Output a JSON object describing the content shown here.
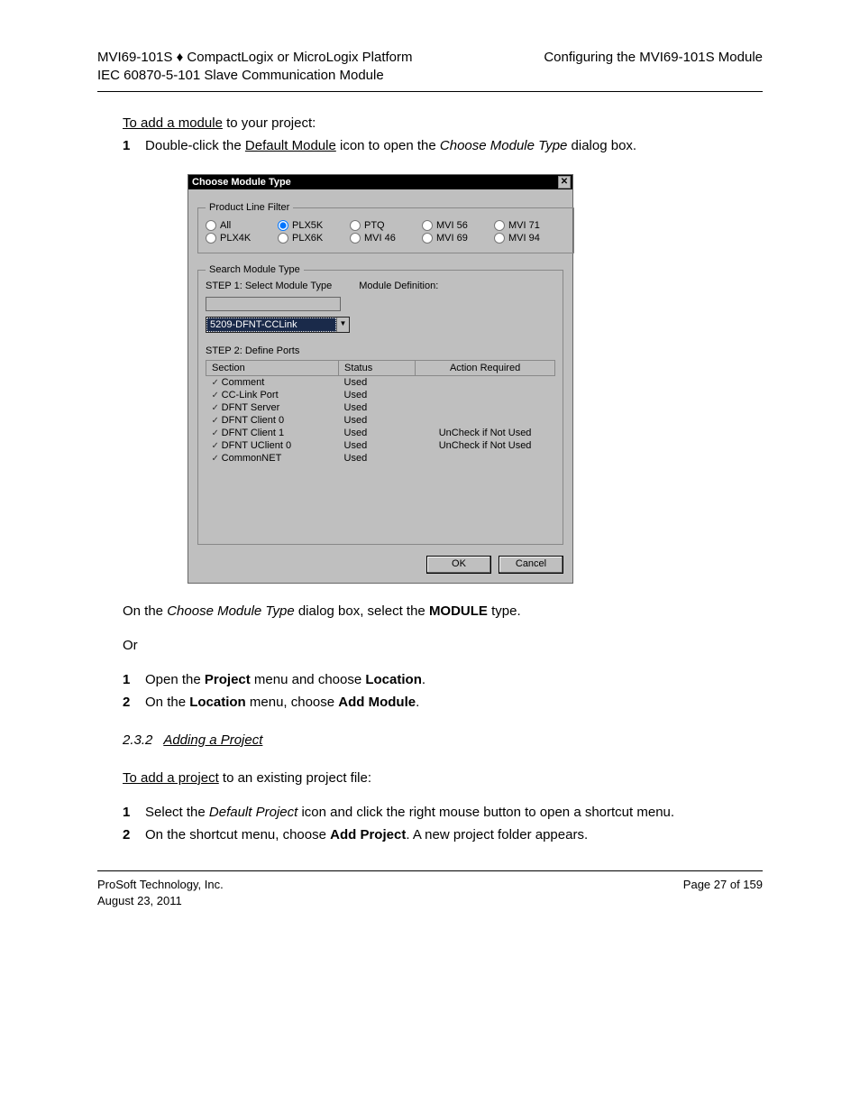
{
  "header": {
    "left_line1_a": "MVI69-101S",
    "left_line1_b": "CompactLogix or MicroLogix Platform",
    "left_line2": "IEC 60870-5-101 Slave Communication Module",
    "right_line1": "Configuring the MVI69-101S Module",
    "diamond": "♦"
  },
  "intro": {
    "line1_a": "To add a module",
    "line1_b": " to your project:",
    "step_label": "1",
    "step_text_a": "Double-click the ",
    "step_text_b": "Default Module",
    "step_text_c": " icon to open the ",
    "step_text_d": "Choose Module Type",
    "step_text_e": " dialog box."
  },
  "dialog": {
    "title": "Choose Module Type",
    "close": "✕",
    "fieldsets": {
      "product_line": "Product Line Filter",
      "search_module": "Search Module Type"
    },
    "radios": {
      "row1": [
        {
          "label": "All",
          "checked": false
        },
        {
          "label": "PLX5K",
          "checked": true
        },
        {
          "label": "PTQ",
          "checked": false
        },
        {
          "label": "MVI 56",
          "checked": false
        },
        {
          "label": "MVI 71",
          "checked": false
        }
      ],
      "row2": [
        {
          "label": "PLX4K",
          "checked": false
        },
        {
          "label": "PLX6K",
          "checked": false
        },
        {
          "label": "MVI 46",
          "checked": false
        },
        {
          "label": "MVI 69",
          "checked": false
        },
        {
          "label": "MVI 94",
          "checked": false
        }
      ]
    },
    "smt": {
      "step1": "STEP 1: Select Module Type",
      "moddef": "Module Definition:",
      "combo_value": "5209-DFNT-CCLink",
      "combo_btn": "▼",
      "step2": "STEP 2: Define Ports"
    },
    "table": {
      "headers": {
        "section": "Section",
        "status": "Status",
        "action": "Action Required"
      },
      "rows": [
        {
          "section": "Comment",
          "status": "Used",
          "action": ""
        },
        {
          "section": "CC-Link Port",
          "status": "Used",
          "action": ""
        },
        {
          "section": "DFNT Server",
          "status": "Used",
          "action": ""
        },
        {
          "section": "DFNT Client 0",
          "status": "Used",
          "action": ""
        },
        {
          "section": "DFNT Client 1",
          "status": "Used",
          "action": "UnCheck if Not Used"
        },
        {
          "section": "DFNT UClient 0",
          "status": "Used",
          "action": "UnCheck if Not Used"
        },
        {
          "section": "CommonNET",
          "status": "Used",
          "action": ""
        }
      ]
    },
    "buttons": {
      "ok": "OK",
      "cancel": "Cancel"
    }
  },
  "after": {
    "p1_a": "On the ",
    "p1_b": "Choose Module Type",
    "p1_c": " dialog box, select the ",
    "p1_d": "MODULE",
    "p1_e": " type.",
    "p2": "Or",
    "p3_a": "1",
    "p3_b": "Open the ",
    "p3_c": "Project",
    "p3_d": " menu and choose ",
    "p3_e": "Location",
    "p3_f": ".",
    "p4_a": "2",
    "p4_b": "On the ",
    "p4_c": "Location",
    "p4_d": " menu, choose ",
    "p4_e": "Add Module",
    "p4_f": "."
  },
  "heading232": {
    "num": "2.3.2",
    "title": "Adding a Project"
  },
  "addproj": {
    "p1_a": "To add a project",
    "p1_b": " to an existing project file:",
    "p2_a": "1",
    "p2_b": "Select the ",
    "p2_c": "Default Project",
    "p2_d": " icon and click the right mouse button to open a shortcut menu.",
    "p3_a": "2",
    "p3_b": "On the shortcut menu, choose ",
    "p3_c": "Add Project",
    "p3_d": ". A new project folder appears."
  },
  "footer": {
    "left_line1": "ProSoft Technology, Inc.",
    "left_line2": "August 23, 2011",
    "right_line1": "Page 27 of 159"
  }
}
